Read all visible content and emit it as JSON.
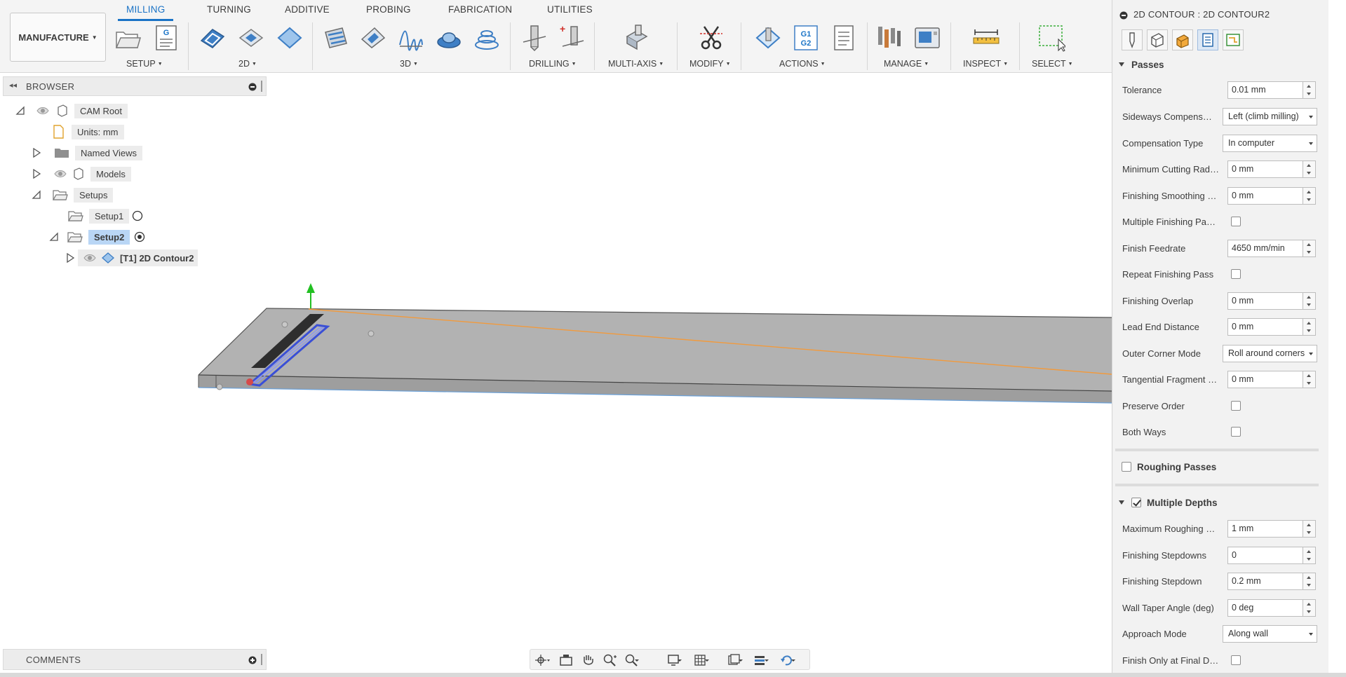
{
  "toolbar": {
    "tabs": [
      {
        "label": "MILLING",
        "active": true
      },
      {
        "label": "TURNING"
      },
      {
        "label": "ADDITIVE"
      },
      {
        "label": "PROBING"
      },
      {
        "label": "FABRICATION"
      },
      {
        "label": "UTILITIES"
      }
    ],
    "workspace_label": "MANUFACTURE",
    "groups": [
      "SETUP",
      "2D",
      "3D",
      "DRILLING",
      "MULTI-AXIS",
      "MODIFY",
      "ACTIONS",
      "MANAGE",
      "INSPECT",
      "SELECT"
    ],
    "g1g2_text": [
      "G1",
      "G2"
    ],
    "accent_color": "#1a73c6"
  },
  "browser": {
    "title": "BROWSER",
    "items": [
      {
        "label": "CAM Root"
      },
      {
        "label": "Units: mm"
      },
      {
        "label": "Named Views"
      },
      {
        "label": "Models"
      },
      {
        "label": "Setups"
      },
      {
        "label": "Setup1"
      },
      {
        "label": "Setup2",
        "selected": true
      },
      {
        "label": "[T1] 2D Contour2"
      }
    ]
  },
  "comments": {
    "title": "COMMENTS"
  },
  "properties": {
    "title": "2D CONTOUR : 2D CONTOUR2",
    "sections": {
      "passes": "Passes",
      "roughing": "Roughing Passes",
      "multiple_depths": "Multiple Depths"
    },
    "rows": [
      {
        "label": "Tolerance",
        "value": "0.01 mm"
      },
      {
        "label": "Sideways Compensation",
        "value": "Left (climb milling)"
      },
      {
        "label": "Compensation Type",
        "value": "In computer"
      },
      {
        "label": "Minimum Cutting Radius",
        "value": "0 mm"
      },
      {
        "label": "Finishing Smoothing Deviation",
        "value": "0 mm"
      },
      {
        "label": "Multiple Finishing Passes",
        "value": ""
      },
      {
        "label": "Finish Feedrate",
        "value": "4650 mm/min"
      },
      {
        "label": "Repeat Finishing Pass",
        "value": ""
      },
      {
        "label": "Finishing Overlap",
        "value": "0 mm"
      },
      {
        "label": "Lead End Distance",
        "value": "0 mm"
      },
      {
        "label": "Outer Corner Mode",
        "value": "Roll around corners"
      },
      {
        "label": "Tangential Fragment Extension",
        "value": "0 mm"
      },
      {
        "label": "Preserve Order",
        "value": ""
      },
      {
        "label": "Both Ways",
        "value": ""
      },
      {
        "label": "Maximum Roughing Stepdown",
        "value": "1 mm"
      },
      {
        "label": "Finishing Stepdowns",
        "value": "0"
      },
      {
        "label": "Finishing Stepdown",
        "value": "0.2 mm"
      },
      {
        "label": "Wall Taper Angle (deg)",
        "value": "0 deg"
      },
      {
        "label": "Approach Mode",
        "value": "Along wall"
      },
      {
        "label": "Finish Only at Final Depth",
        "value": ""
      }
    ]
  }
}
